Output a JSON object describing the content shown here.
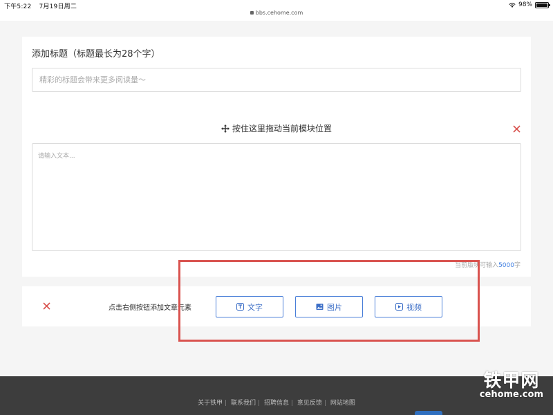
{
  "status_bar": {
    "time": "下午5:22",
    "date": "7月19日周二",
    "url": "bbs.cehome.com",
    "battery": "98%",
    "battery_level": 0.98
  },
  "title_section": {
    "label": "添加标题（标题最长为28个字）",
    "placeholder": "精彩的标题会带来更多阅读量～"
  },
  "text_module": {
    "drag_label": "按住这里拖动当前模块位置",
    "placeholder": "请输入文本...",
    "counter_prefix": "当前版块可输入",
    "counter_value": "5000",
    "counter_suffix": "字"
  },
  "add_section": {
    "hint": "点击右侧按钮添加文章元素",
    "buttons": [
      {
        "label": "文字",
        "icon": "text-icon"
      },
      {
        "label": "图片",
        "icon": "image-icon"
      },
      {
        "label": "视频",
        "icon": "video-icon"
      }
    ]
  },
  "footer": {
    "links": [
      "关于铁甲",
      "联系我们",
      "招聘信息",
      "意见反馈",
      "网站地图"
    ],
    "separator": "|"
  },
  "watermark": {
    "main": "铁甲网",
    "sub": "cehome.com"
  },
  "colors": {
    "accent": "#3d6fc7",
    "close": "#d9534f",
    "highlight": "#d9534f",
    "footer_bg": "#3d3d3d"
  }
}
